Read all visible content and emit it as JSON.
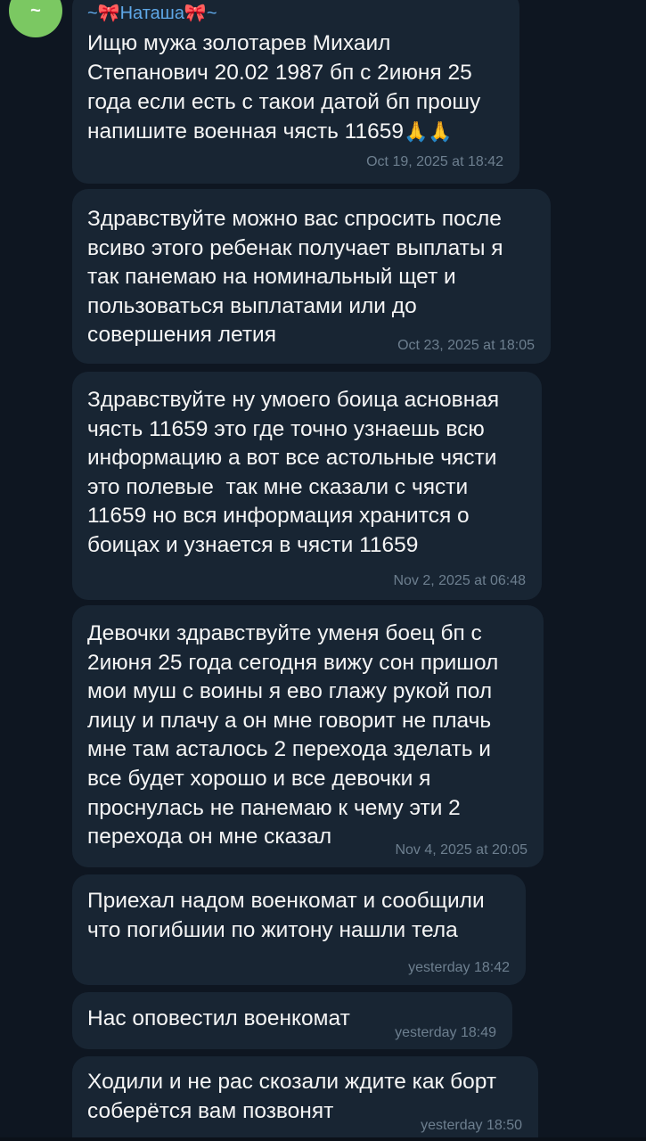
{
  "avatar": {
    "letter": "~"
  },
  "messages": [
    {
      "sender": "~🎀Наташа🎀~",
      "text": "Ищю мужа золотарев Михаил Степанович 20.02 1987 бп с 2июня 25 года если есть с такои датой бп прошу напишите военная чясть 11659",
      "emoji": "🙏🙏",
      "time": "Oct 19, 2025 at 18:42"
    },
    {
      "text": "Здравствуйте можно вас спросить после всиво этого ребенак получает выплаты я так панемаю на номинальный щет и пользоваться выплатами или до совершения летия",
      "time": "Oct 23, 2025 at 18:05"
    },
    {
      "text": "Здравствуйте ну умоего боица асновная чясть 11659 это где точно узнаешь всю информацию а вот все астольные чясти это полевые  так мне сказали с чясти 11659 но вся информация хранится о боицах и узнается в чясти 11659",
      "time": "Nov 2, 2025 at 06:48"
    },
    {
      "text": "Девочки здравствуйте уменя боец бп с 2июня 25 года сегодня вижу сон пришол мои муш с воины я ево глажу рукой пол лицу и плачу а он мне говорит не плачь мне там асталось 2 перехода зделать и все будет хорошо и все девочки я проснулась не панемаю к чему эти 2 перехода он мне сказал",
      "time": "Nov 4, 2025 at 20:05"
    },
    {
      "text": "Приехал надом военкомат и сообщили что погибшии по житону нашли тела",
      "time": "yesterday 18:42"
    },
    {
      "text": "Нас оповестил военкомат",
      "time": "yesterday 18:49"
    },
    {
      "text": "Ходили и не рас скозали ждите как борт соберётся вам позвонят",
      "time": "yesterday 18:50"
    }
  ]
}
